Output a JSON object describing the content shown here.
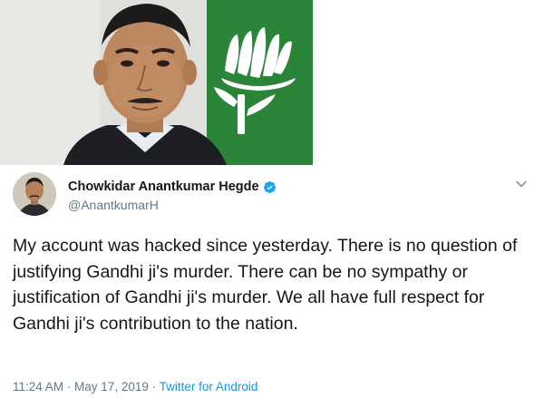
{
  "tweet": {
    "display_name": "Chowkidar Anantkumar Hegde",
    "handle": "@AnantkumarH",
    "verified": true,
    "text": "My account was hacked since yesterday. There is no question of justifying Gandhi ji's murder. There can be no sympathy or justification of Gandhi ji's murder. We all have full respect for Gandhi ji's contribution to the nation.",
    "time": "11:24 AM",
    "separator": " · ",
    "date": "May 17, 2019",
    "source": "Twitter for Android"
  },
  "icons": {
    "verified": "verified-badge-icon",
    "menu": "chevron-down-icon"
  },
  "colors": {
    "verified_blue": "#1da1f2",
    "link_blue": "#1b95e0",
    "meta_gray": "#657786",
    "text_dark": "#14171a",
    "party_green": "#2f8a3c"
  }
}
